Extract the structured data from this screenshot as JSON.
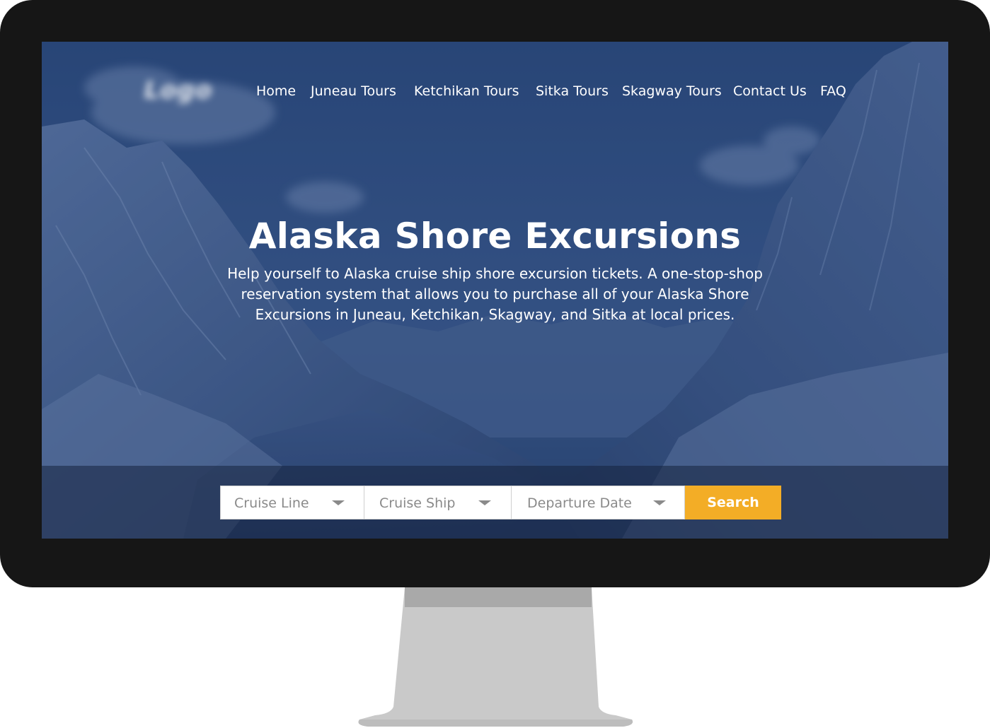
{
  "site": {
    "logo_text": "Logo"
  },
  "nav": {
    "items": [
      {
        "label": "Home"
      },
      {
        "label": "Juneau Tours"
      },
      {
        "label": "Ketchikan Tours"
      },
      {
        "label": "Sitka Tours"
      },
      {
        "label": "Skagway Tours"
      },
      {
        "label": "Contact Us"
      },
      {
        "label": "FAQ"
      }
    ]
  },
  "hero": {
    "title": "Alaska Shore Excursions",
    "subtitle": "Help yourself to Alaska cruise ship shore excursion tickets. A one-stop-shop reservation system that allows you to purchase all of your Alaska Shore Excursions in Juneau, Ketchikan, Skagway, and Sitka at local prices."
  },
  "search": {
    "cruise_line_placeholder": "Cruise Line",
    "cruise_ship_placeholder": "Cruise Ship",
    "departure_date_placeholder": "Departure Date",
    "button_label": "Search",
    "dropdown_icon": "caret-down-icon"
  },
  "colors": {
    "accent": "#f3ad26",
    "hero_overlay": "#2c4877",
    "bezel": "#161616",
    "stand": "#c8c8c8"
  }
}
